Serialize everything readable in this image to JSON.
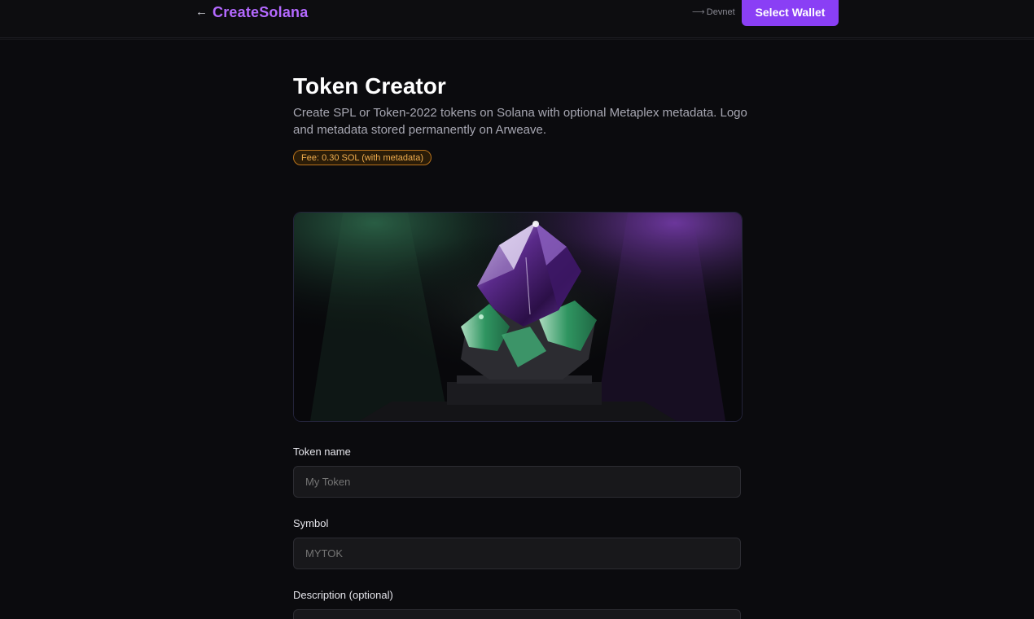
{
  "header": {
    "back_icon": "arrow-left-icon",
    "brand": "CreateSolana",
    "network_icon": "arrow-right-icon",
    "network": "Devnet",
    "wallet_button": "Select Wallet"
  },
  "main": {
    "title": "Token Creator",
    "subtitle": "Create SPL or Token-2022 tokens on Solana with optional Metaplex metadata. Logo and metadata stored permanently on Arweave.",
    "fee_badge": "Fee: 0.30 SOL (with metadata)",
    "hero_image": "crystal-gem-illustration"
  },
  "form": {
    "token_name": {
      "label": "Token name",
      "placeholder": "My Token",
      "value": ""
    },
    "symbol": {
      "label": "Symbol",
      "placeholder": "MYTOK",
      "value": ""
    },
    "description": {
      "label": "Description (optional)",
      "placeholder": "",
      "value": ""
    }
  },
  "colors": {
    "accent": "#8a3ff5",
    "brand": "#b469ff",
    "fee": "#f0ad4e",
    "background": "#0b0b0e"
  }
}
